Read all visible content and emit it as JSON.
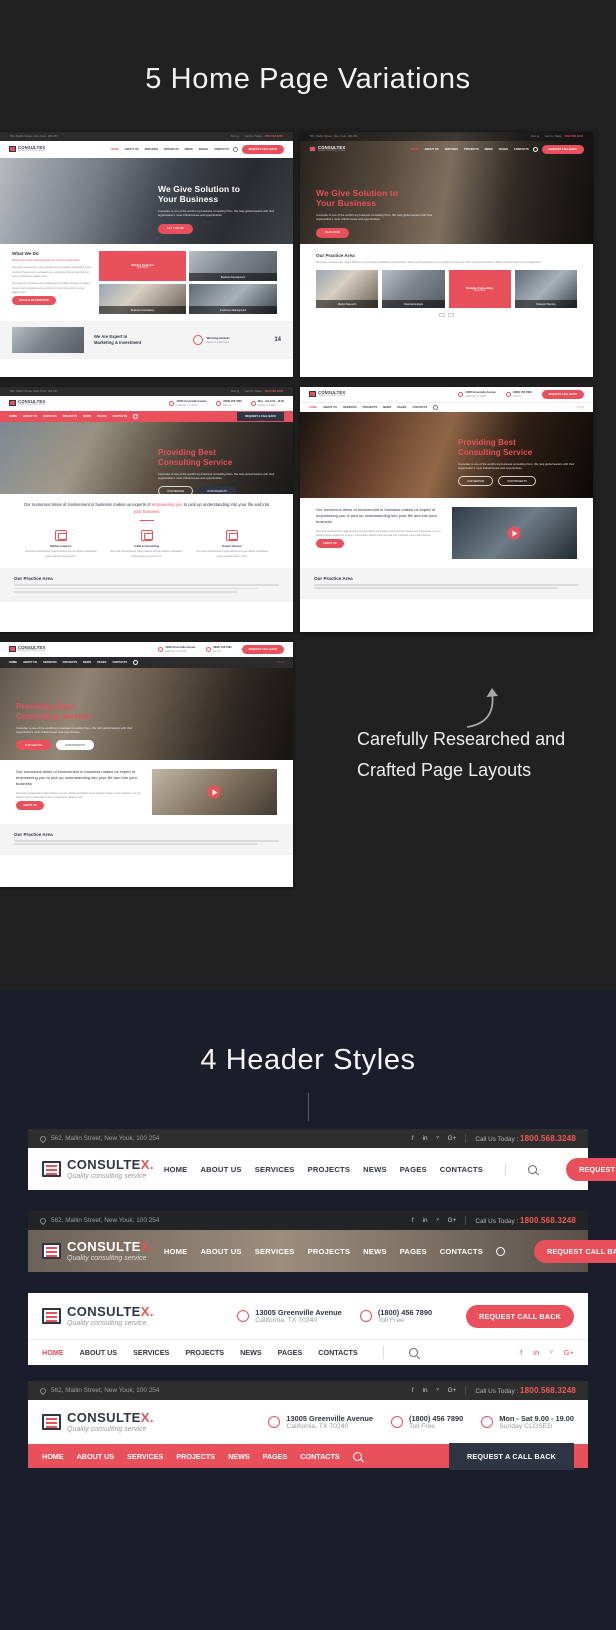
{
  "sections": {
    "home_variations": {
      "title": "5 Home Page Variations",
      "note": "Carefully Researched and Crafted Page Layouts"
    },
    "header_styles": {
      "title": "4 Header Styles"
    }
  },
  "brand": {
    "name": "CONSULTEX",
    "name_main": "CONSULTE",
    "name_accent": "X.",
    "tagline": "Quality consulting service",
    "accent_color": "#e8505b",
    "dark_color": "#2f3542"
  },
  "topbar": {
    "address": "562, Mallin Street, New Youk, 100 254",
    "call_label": "Call Us Today :",
    "phone": "1800.568.3248",
    "socials": [
      "f",
      "in",
      "ᵛ",
      "G+"
    ]
  },
  "menu": [
    "HOME",
    "ABOUT US",
    "SERVICES",
    "PROJECTS",
    "NEWS",
    "PAGES",
    "CONTACTS"
  ],
  "cta": {
    "request_call_back": "REQUEST CALL BACK",
    "request_a_call_back": "REQUEST A CALL BACK",
    "read_more": "READ MORE",
    "our_service": "OUR SERVICE",
    "our_projects": "OUR PROJECTS",
    "about_us": "ABOUT US",
    "details": "DETAILS INFORMATION"
  },
  "contact_blocks": [
    {
      "icon": "location-icon",
      "line1": "13005 Greenville Avenue",
      "line2": "California, TX 70240"
    },
    {
      "icon": "phone-icon",
      "line1": "(1800) 456 7890",
      "line2": "Toll Free"
    },
    {
      "icon": "clock-icon",
      "line1": "Mon - Sat 9.00 - 19.00",
      "line2": "Sunday CLOSED"
    }
  ],
  "thumbnails": [
    {
      "id": "home-1",
      "hero_title_1": "We Give Solution to",
      "hero_title_2": "Your Business",
      "hero_body": "Consultex is one of the world's top business consulting firms. We help global leaders with their organization's most critical issues and opportunities.",
      "hero_btn": "GET STARTED",
      "block_title": "What We Do",
      "block_sub": "Works aims proin volutpat aliquam an mauris ut aspernatis",
      "block_body": "Sed quia consequuntur magni dolores eos qui ratione voluptatem sequi nesciunt. Neque porro quisquam est, qui dolorem ipsum quia dolor sit amet, consectetur, adipisci velit.",
      "block_body2": "Sed quia non numquam eius modi tempora incidunt ut labore et dolore. Neque porro quisquam est, qui dolorem ipsum quia dolor sit amet adipisci velit.",
      "cards": [
        "Market Analysis",
        "Business Development",
        "Business Consultancy",
        "Investment Management"
      ],
      "card_red_title": "Market Analysis",
      "card_red_sub": "Read More",
      "footer_title_1": "We Are Expert In",
      "footer_title_2": "Marketing & Investment",
      "stat_label": "Winning Awards",
      "stat_sub": "Based on quality work",
      "stat_value": "14"
    },
    {
      "id": "home-2",
      "hero_title_1": "We Give Solution to",
      "hero_title_2a": "Your ",
      "hero_title_2b": "Business",
      "hero_body": "Consultex is one of the world's top business consulting firms. We help global leaders with their organization's most critical issues and opportunities.",
      "hero_btn": "READ MORE",
      "block_title": "Our Practice Area",
      "block_body": "Child spec consequuntur magni dolores eos qui ratione voluptatem sequi nesciunt. Neque porro quisquam est, qui dolorem ipsum quia dolor sit amet consectetur, adipisci velit sed quia non numquam eius.",
      "cards": [
        "Market Research",
        "Financial Analysis",
        "Sample Consulting",
        "Strategic Planning"
      ],
      "card_red_title": "Sample Consulting",
      "card_red_sub": "Read More"
    },
    {
      "id": "home-3",
      "hero_title_1": "Providing Best",
      "hero_title_2": "Consulting Service",
      "hero_body": "Consultex is one of the world's top business consulting firms. We help global leaders with their organization's most critical issues and opportunities.",
      "hero_btn_1": "OUR SERVICE",
      "hero_btn_2": "OUR PROJECTS",
      "intro_a": "Our numerous times of involvement in business makes us experts of ",
      "intro_accent_1": "empowering you",
      "intro_b": " to pick up understanding into your life and into ",
      "intro_accent_2": "your business",
      "features": [
        {
          "name": "Market Analysis",
          "body": "Sed quia consequuntur magni dolores eos qui ratione voluptatem sequi nesciunt neque porro."
        },
        {
          "name": "Audit & Consulting",
          "body": "Sed quia consequuntur magni dolores eos qui ratione voluptatem sequi nesciunt neque porro."
        },
        {
          "name": "Expert Advisor",
          "body": "Sed quia consequuntur magni dolores eos qui ratione voluptatem sequi nesciunt neque porro."
        }
      ],
      "footer_title": "Our Practice Area"
    },
    {
      "id": "home-4",
      "hero_title_1": "Providing Best",
      "hero_title_2": "Consulting Service",
      "hero_body": "Consultex is one of the world's top business consulting firms. We help global leaders with their organization's most critical issues and opportunities.",
      "hero_btn_1": "OUR SERVICE",
      "hero_btn_2": "OUR PROJECTS",
      "intro": "Our numerous times of involvement in business makes us expert of empowering you to pick up understanding into your life and into your business",
      "body": "Sed quia consequuntur magni dolores eos qui ratione voluptatem sequi nesciunt. Neque porro quisquam est, qui dolorem ipsum quia dolor sit amet, consectetur adipisci velit sed quia non numquam eius modi tempora.",
      "btn": "ABOUT US",
      "footer_title": "Our Practice Area"
    },
    {
      "id": "home-5",
      "hero_title_1": "Providing Best",
      "hero_title_2": "Consulting Service",
      "hero_body": "Consultex is one of the world's top business consulting firms. We help global leaders with their organization's most critical issues and opportunities.",
      "hero_btn_1": "OUR SERVICE",
      "hero_btn_2": "OUR PROJECTS",
      "intro": "Our numerous times of involvement in business makes us expert of empowering you to pick up understanding into your life and into your business",
      "body": "Sed quia consequuntur magni dolores eos qui ratione voluptatem sequi nesciunt. Neque porro quisquam est, qui dolorem ipsum quia dolor sit amet, consectetur adipisci velit.",
      "btn": "ABOUT US",
      "footer_title": "Our Practice Area"
    }
  ],
  "headers": [
    {
      "id": "header-1",
      "style": "dark-topbar-white-nav"
    },
    {
      "id": "header-2",
      "style": "transparent-over-image"
    },
    {
      "id": "header-3",
      "style": "white-with-contact-info"
    },
    {
      "id": "header-4",
      "style": "topbar-contact-red-nav"
    }
  ]
}
